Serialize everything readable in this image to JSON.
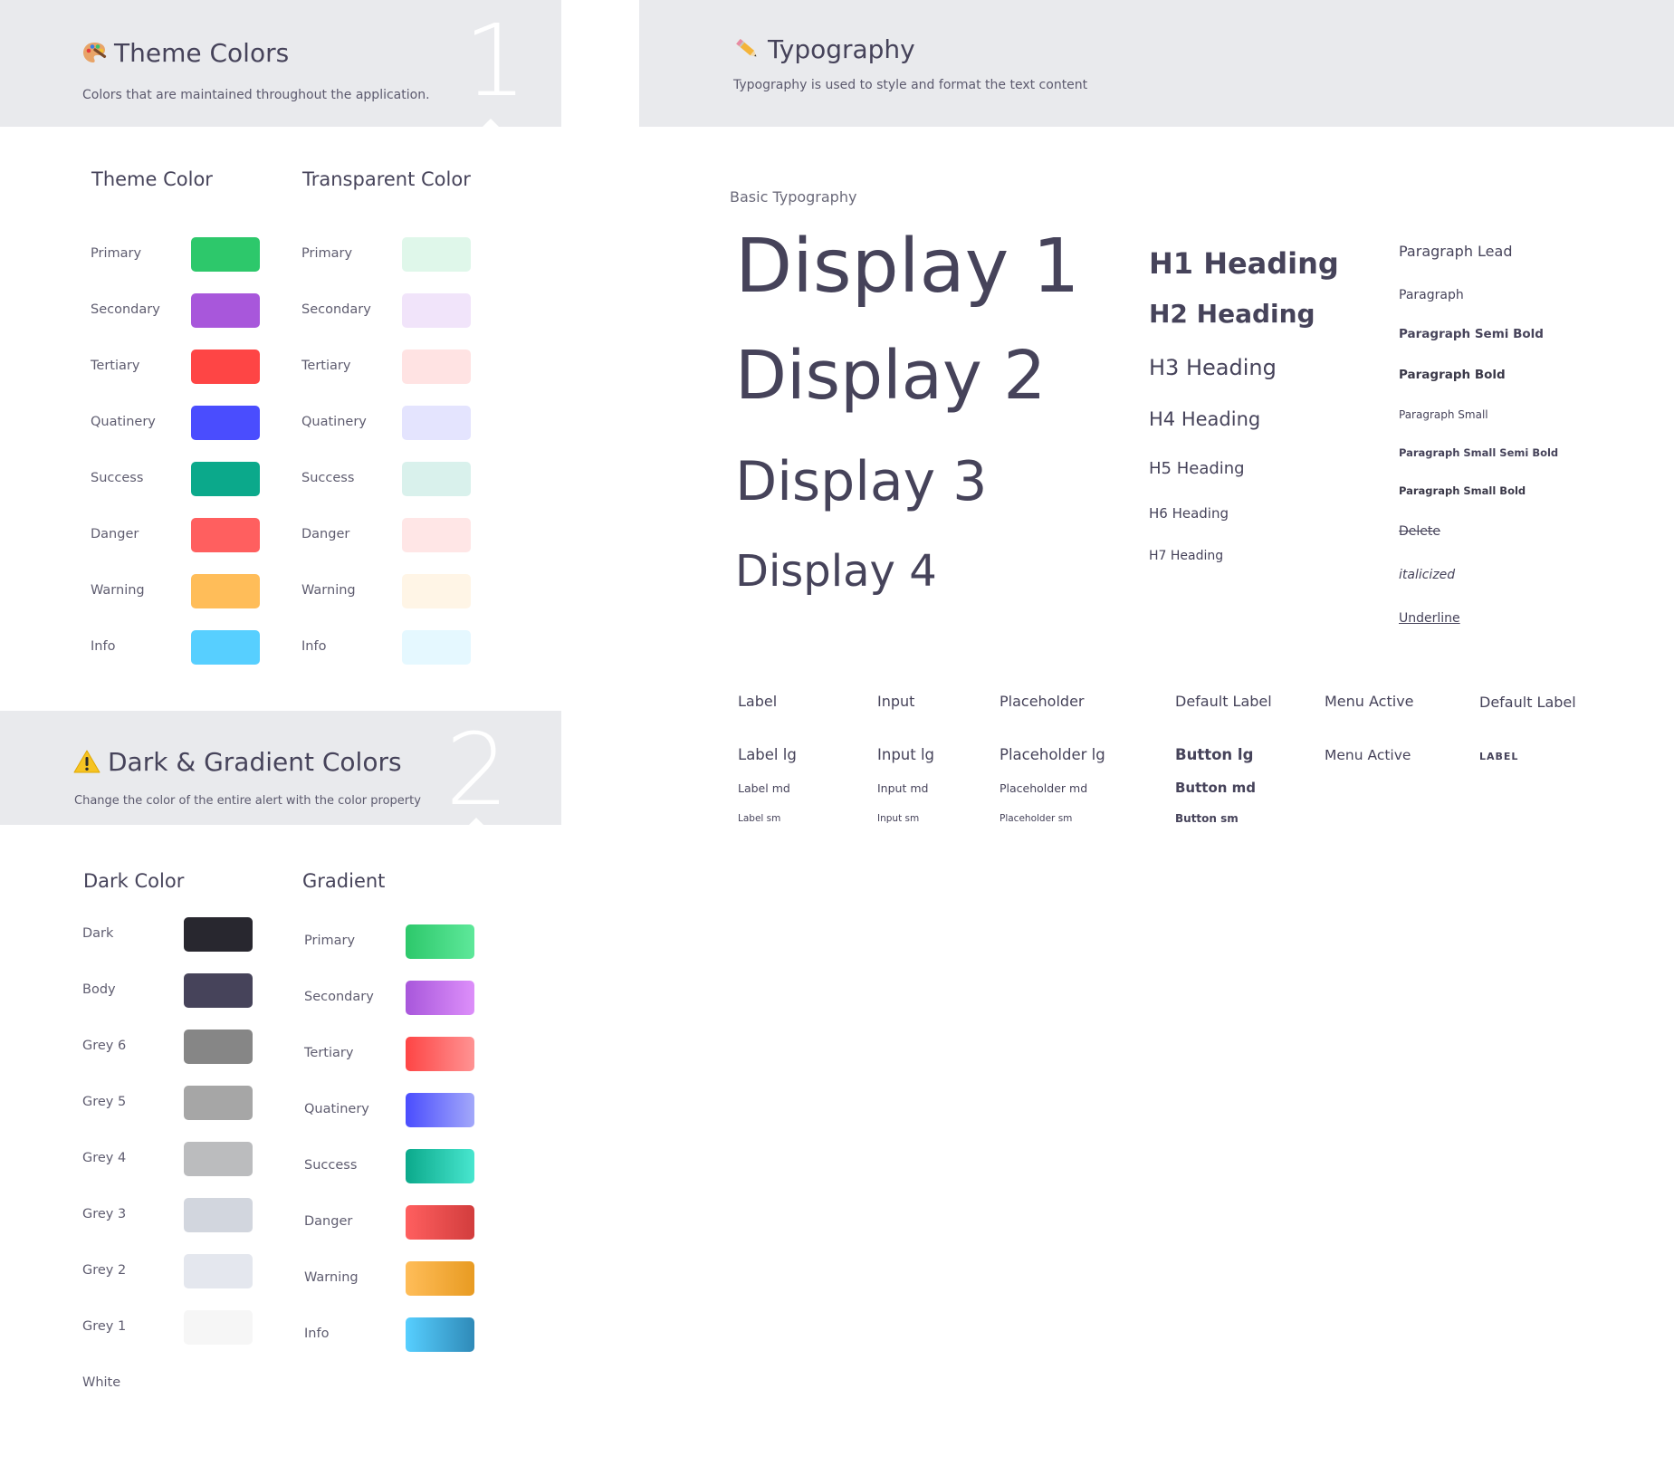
{
  "theme_panel": {
    "title": "Theme Colors",
    "subtitle": "Colors that are maintained throughout the application.",
    "number": "1",
    "icon": "palette-icon",
    "theme_column_title": "Theme Color",
    "transparent_column_title": "Transparent Color",
    "theme_colors": [
      {
        "label": "Primary",
        "color": "#2dc86b"
      },
      {
        "label": "Secondary",
        "color": "#a857db"
      },
      {
        "label": "Tertiary",
        "color": "#fe4545"
      },
      {
        "label": "Quatinery",
        "color": "#4a4dfe"
      },
      {
        "label": "Success",
        "color": "#0ba98b"
      },
      {
        "label": "Danger",
        "color": "#ff5f5f"
      },
      {
        "label": "Warning",
        "color": "#ffbd59"
      },
      {
        "label": "Info",
        "color": "#57cfff"
      }
    ],
    "transparent_colors": [
      {
        "label": "Primary",
        "color": "#dff7ea"
      },
      {
        "label": "Secondary",
        "color": "#f1e4fa"
      },
      {
        "label": "Tertiary",
        "color": "#ffe3e3"
      },
      {
        "label": "Quatinery",
        "color": "#e4e4fe"
      },
      {
        "label": "Success",
        "color": "#d9f1ec"
      },
      {
        "label": "Danger",
        "color": "#ffe6e6"
      },
      {
        "label": "Warning",
        "color": "#fff5e6"
      },
      {
        "label": "Info",
        "color": "#e5f8ff"
      }
    ]
  },
  "dark_panel": {
    "title": "Dark & Gradient Colors",
    "subtitle": "Change the color of the entire alert with the color property",
    "number": "2",
    "icon": "warning-icon",
    "dark_column_title": "Dark Color",
    "gradient_column_title": "Gradient",
    "dark_colors": [
      {
        "label": "Dark",
        "color": "#28272f"
      },
      {
        "label": "Body",
        "color": "#46435a"
      },
      {
        "label": "Grey 6",
        "color": "#868686"
      },
      {
        "label": "Grey 5",
        "color": "#a6a6a6"
      },
      {
        "label": "Grey 4",
        "color": "#bbbcbe"
      },
      {
        "label": "Grey 3",
        "color": "#d2d6de"
      },
      {
        "label": "Grey 2",
        "color": "#e4e7ee"
      },
      {
        "label": "Grey 1",
        "color": "#f6f6f6"
      },
      {
        "label": "White",
        "color": "#ffffff"
      }
    ],
    "gradients": [
      {
        "label": "Primary",
        "from": "#2dc86b",
        "to": "#5ee89a"
      },
      {
        "label": "Secondary",
        "from": "#a857db",
        "to": "#dd8ffa"
      },
      {
        "label": "Tertiary",
        "from": "#fe4545",
        "to": "#ff9393"
      },
      {
        "label": "Quatinery",
        "from": "#4a4dfe",
        "to": "#a3a8fa"
      },
      {
        "label": "Success",
        "from": "#0ba98b",
        "to": "#48e6cf"
      },
      {
        "label": "Danger",
        "from": "#ff5f5f",
        "to": "#d23d3d"
      },
      {
        "label": "Warning",
        "from": "#ffbd59",
        "to": "#e89b22"
      },
      {
        "label": "Info",
        "from": "#57cfff",
        "to": "#2f8ab8"
      }
    ]
  },
  "typography_panel": {
    "title": "Typography",
    "subtitle": "Typography is used to style and format the text content",
    "icon": "pencil-icon",
    "section_label": "Basic Typography",
    "displays": [
      "Display 1",
      "Display 2",
      "Display 3",
      "Display 4"
    ],
    "headings": [
      "H1 Heading",
      "H2 Heading",
      "H3 Heading",
      "H4 Heading",
      "H5 Heading",
      "H6 Heading",
      "H7 Heading"
    ],
    "paragraphs": [
      "Paragraph Lead",
      "Paragraph",
      "Paragraph Semi Bold",
      "Paragraph Bold",
      "Paragraph Small",
      "Paragraph Small Semi Bold",
      "Paragraph Small Bold",
      "Delete",
      "italicized",
      "Underline"
    ],
    "form_rows": {
      "row1": [
        "Label",
        "Input",
        "Placeholder",
        "Default Label",
        "Menu Active",
        "Default Label"
      ],
      "row2": [
        "Label lg",
        "Input lg",
        "Placeholder lg",
        "Button lg",
        "Menu Active",
        "LABEL"
      ],
      "row3": [
        "Label md",
        "Input md",
        "Placeholder md",
        "Button md"
      ],
      "row4": [
        "Label sm",
        "Input sm",
        "Placeholder sm",
        "Button sm"
      ]
    }
  }
}
